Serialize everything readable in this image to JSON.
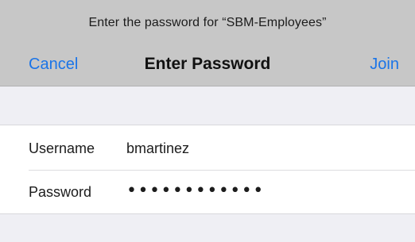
{
  "header": {
    "prompt": "Enter the password for “SBM-Employees”",
    "cancel_label": "Cancel",
    "title": "Enter Password",
    "join_label": "Join"
  },
  "form": {
    "username": {
      "label": "Username",
      "value": "bmartinez"
    },
    "password": {
      "label": "Password",
      "value": "••••••••••••"
    }
  },
  "colors": {
    "accent": "#1a74e8",
    "header_bg": "#c7c7c7",
    "page_bg": "#efeff4"
  }
}
